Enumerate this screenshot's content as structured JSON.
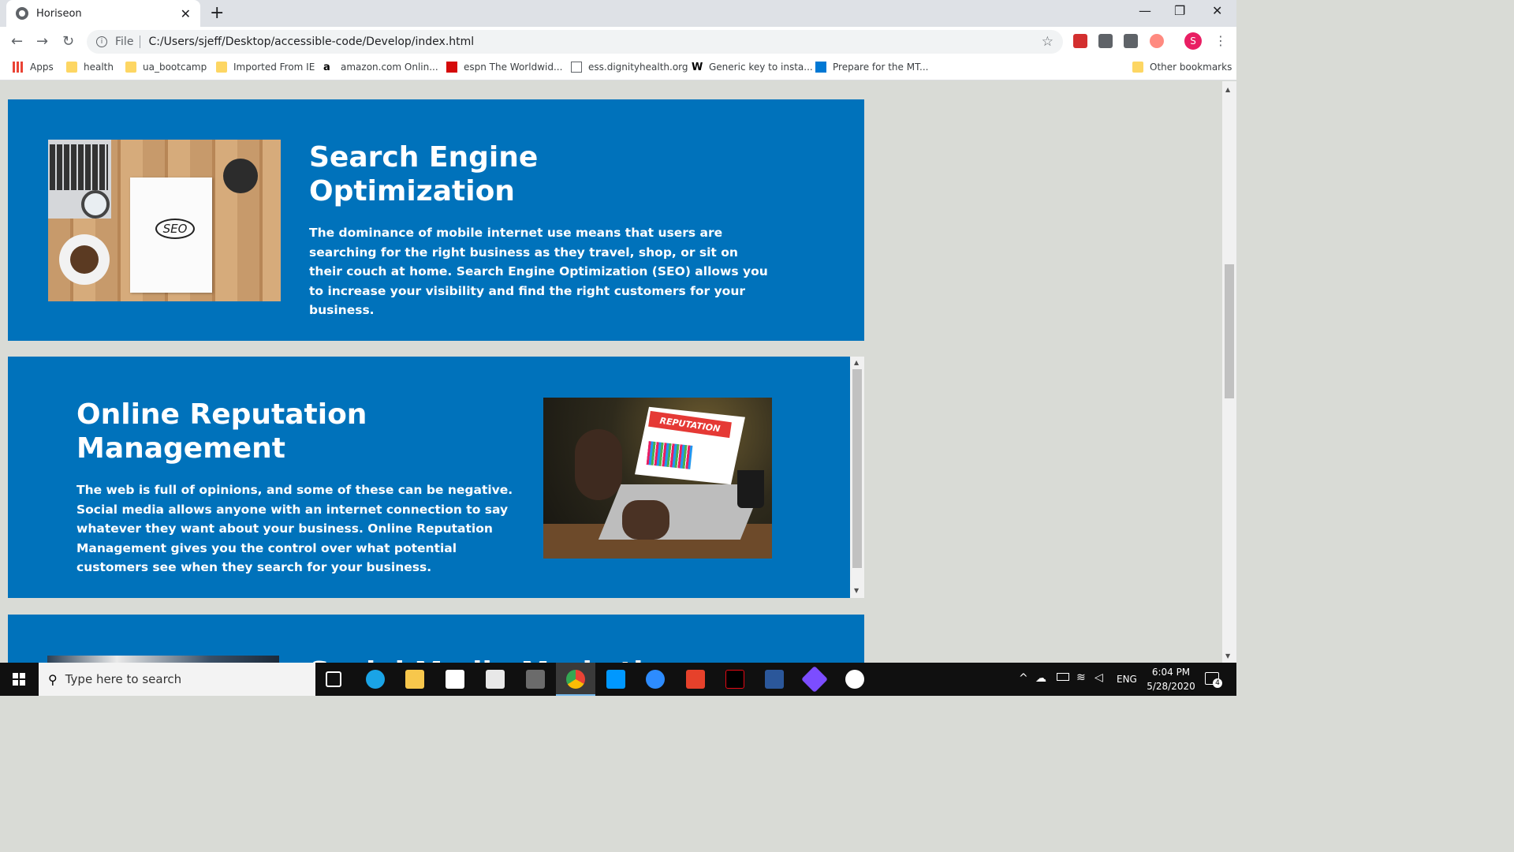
{
  "browser": {
    "tab_title": "Horiseon",
    "new_tab": "+",
    "close_tab": "✕",
    "window_controls": {
      "minimize": "—",
      "restore": "❐",
      "close": "✕"
    },
    "address": {
      "scheme": "File",
      "url": "C:/Users/sjeff/Desktop/accessible-code/Develop/index.html"
    },
    "profile_initial": "S",
    "bookmarks": [
      {
        "label": "Apps",
        "icon": "apps-grid-icon"
      },
      {
        "label": "health",
        "icon": "folder-icon"
      },
      {
        "label": "ua_bootcamp",
        "icon": "folder-icon"
      },
      {
        "label": "Imported From IE",
        "icon": "folder-icon"
      },
      {
        "label": "amazon.com Onlin...",
        "icon": "amazon-icon"
      },
      {
        "label": "espn The Worldwid...",
        "icon": "espn-icon"
      },
      {
        "label": "ess.dignityhealth.org",
        "icon": "page-icon"
      },
      {
        "label": "Generic key to insta...",
        "icon": "w-icon"
      },
      {
        "label": "Prepare for the MT...",
        "icon": "video-icon"
      },
      {
        "label": "Other bookmarks",
        "icon": "folder-icon"
      }
    ]
  },
  "page": {
    "sections": [
      {
        "heading": "Search Engine Optimization",
        "body": "The dominance of mobile internet use means that users are searching for the right business as they travel, shop, or sit on their couch at home. Search Engine Optimization (SEO) allows you to increase your visibility and find the right customers for your business.",
        "image_text": "SEO"
      },
      {
        "heading": "Online Reputation Management",
        "body": "The web is full of opinions, and some of these can be negative. Social media allows anyone with an internet connection to say whatever they want about your business. Online Reputation Management gives you the control over what potential customers see when they search for your business.",
        "image_text": "REPUTATION"
      },
      {
        "heading": "Social Media Marketing"
      }
    ],
    "colors": {
      "card_bg": "#0072bb",
      "page_bg": "#d9dbd6",
      "text": "#ffffff"
    }
  },
  "taskbar": {
    "search_placeholder": "Type here to search",
    "language": "ENG",
    "time": "6:04 PM",
    "date": "5/28/2020",
    "notification_count": "4"
  }
}
